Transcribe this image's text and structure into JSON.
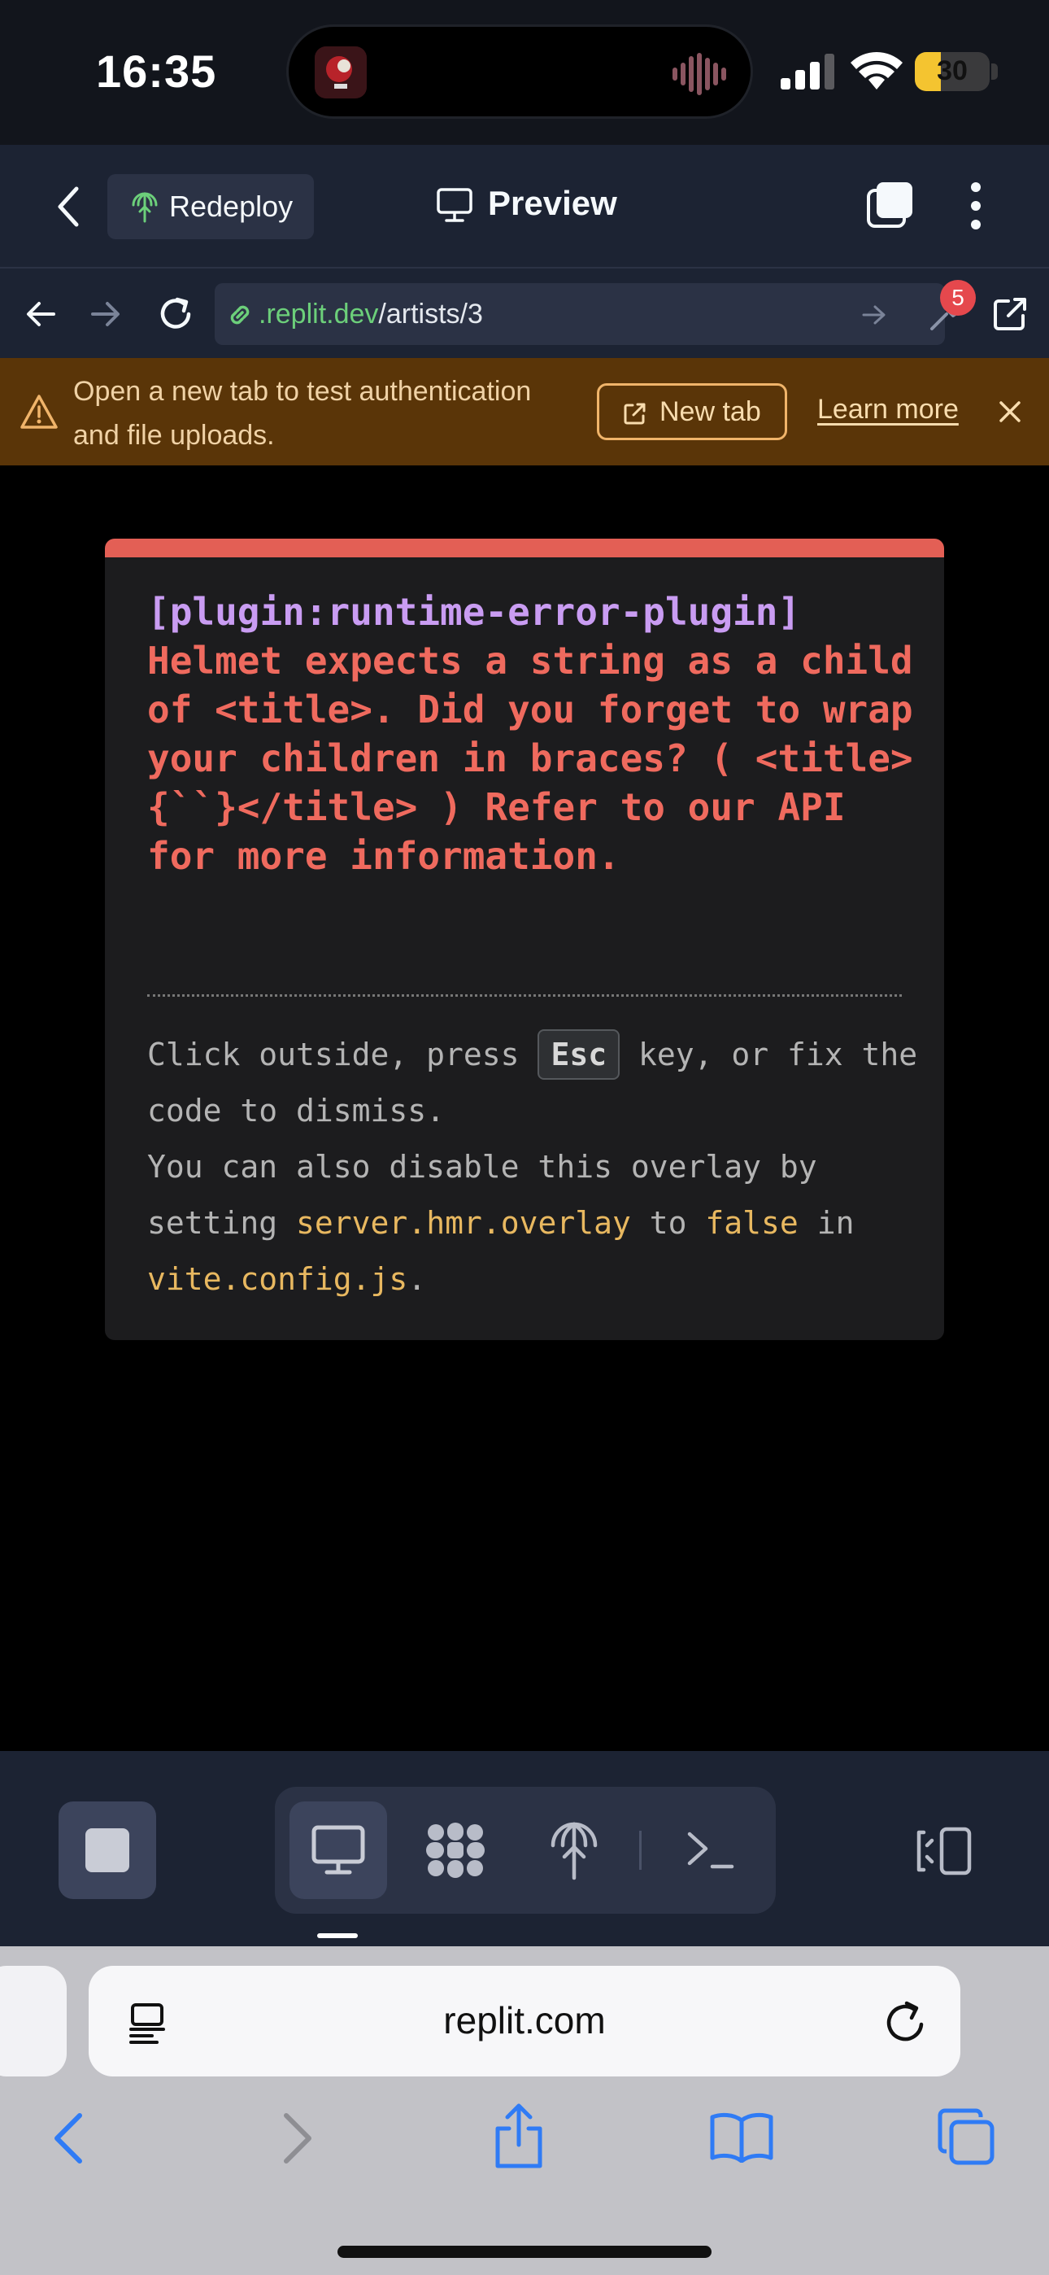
{
  "status_bar": {
    "time": "16:35",
    "battery": "30"
  },
  "header": {
    "back_icon": "chevron-left-icon",
    "redeploy_label": "Redeploy",
    "title": "Preview",
    "tabs_icon": "stacked-squares-icon",
    "menu_icon": "vertical-ellipsis-icon"
  },
  "url_bar": {
    "domain": ".replit.dev",
    "path": "/artists/3",
    "devtools_badge": "5"
  },
  "banner": {
    "message": "Open a new tab to test authentication and file uploads.",
    "new_tab_label": "New tab",
    "learn_more_label": "Learn more"
  },
  "error_overlay": {
    "plugin": "[plugin:runtime-error-plugin]",
    "message": "Helmet expects a string as a child of <title>. Did you forget to wrap your children in braces? ( <title>{``}</title> ) Refer to our API for more information.",
    "tip_1a": "Click outside, press",
    "key": "Esc",
    "tip_1b": "key, or fix the code to dismiss.",
    "tip_2a": "You can also disable this overlay by setting",
    "config_key": "server.hmr.overlay",
    "tip_2b": "to",
    "config_value": "false",
    "tip_2c": "in",
    "config_file": "vite.config.js",
    "tip_2d": "."
  },
  "toolbar": {
    "tabs": [
      "preview-tab",
      "extensions-tab",
      "deploy-tab",
      "shell-tab"
    ]
  },
  "safari": {
    "address": "replit.com"
  },
  "colors": {
    "replit_bg": "#1c2333",
    "banner_bg": "#5a3508",
    "error_red": "#ef6a5e",
    "plugin_purple": "#c99cf2",
    "safari_blue": "#2f7bf5"
  }
}
